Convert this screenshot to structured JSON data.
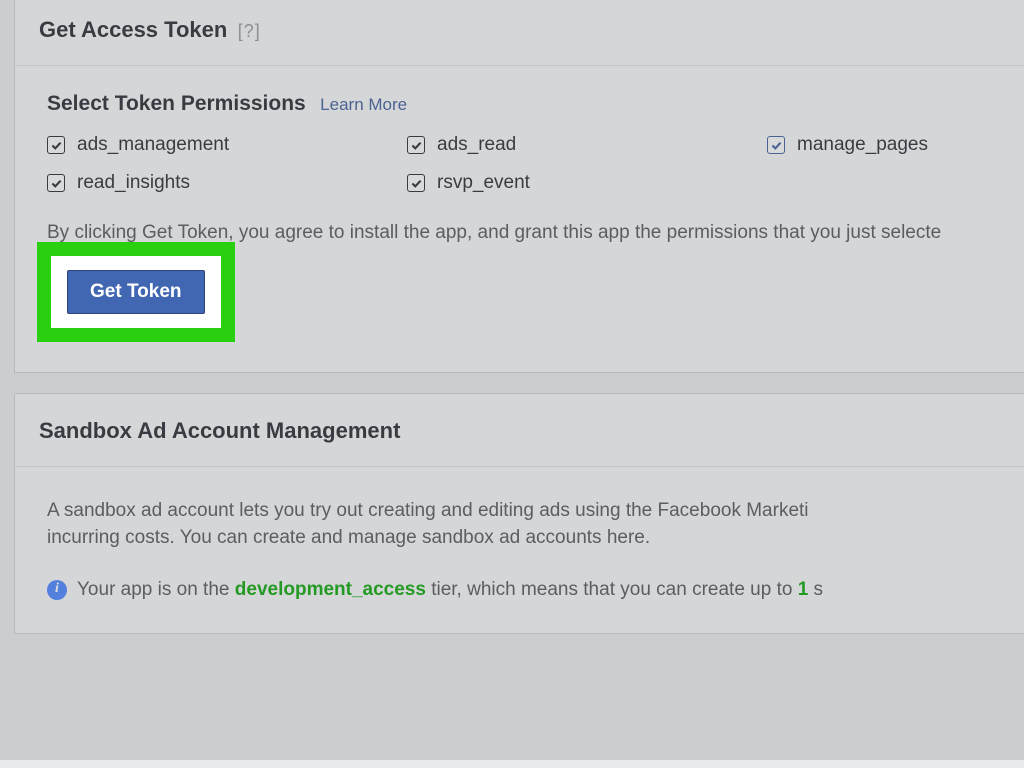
{
  "accessToken": {
    "title": "Get Access Token",
    "help": "[?]",
    "permissionsHeading": "Select Token Permissions",
    "learnMore": "Learn More",
    "permissions": [
      {
        "label": "ads_management",
        "checked": true,
        "accent": false
      },
      {
        "label": "ads_read",
        "checked": true,
        "accent": false
      },
      {
        "label": "manage_pages",
        "checked": true,
        "accent": true
      },
      {
        "label": "read_insights",
        "checked": true,
        "accent": false
      },
      {
        "label": "rsvp_event",
        "checked": true,
        "accent": false
      }
    ],
    "consent": "By clicking Get Token, you agree to install the app, and grant this app the permissions that you just selecte",
    "getTokenLabel": "Get Token"
  },
  "sandbox": {
    "title": "Sandbox Ad Account Management",
    "descriptionPrefix": "A sandbox ad account lets you try out creating and editing ads using the Facebook Marketi",
    "descriptionSuffix": "incurring costs. You can create and manage sandbox ad accounts here.",
    "tierPrefix": "Your app is on the ",
    "tierName": "development_access",
    "tierMid": " tier, which means that you can create up to ",
    "tierCount": "1",
    "tierSuffix": " s"
  }
}
